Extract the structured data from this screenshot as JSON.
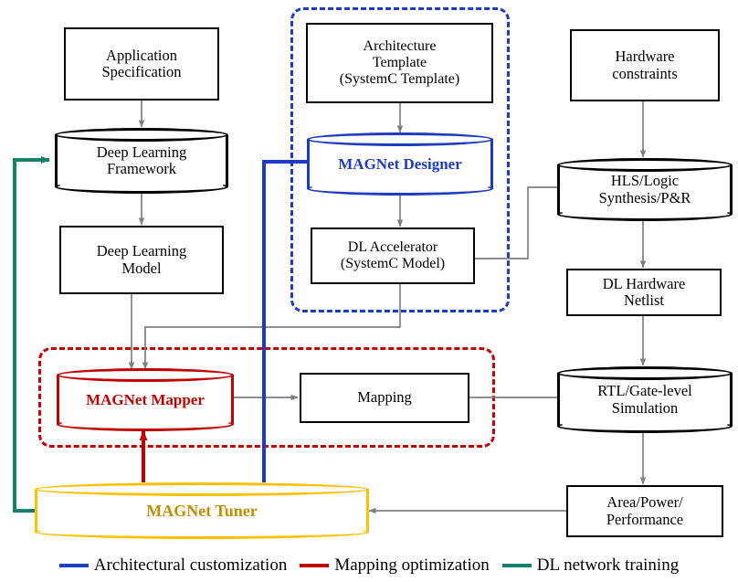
{
  "diagram": {
    "title": "MAGNet design flow",
    "colors": {
      "blue": "#1F3BBF",
      "red": "#C00000",
      "gold": "#FFC000",
      "gold_text": "#BF8F00",
      "teal": "#17806D",
      "arrow_gray": "#808080",
      "black": "#000000"
    },
    "nodes": {
      "application_specification": "Application\nSpecification",
      "deep_learning_framework": "Deep Learning\nFramework",
      "deep_learning_model": "Deep Learning\nModel",
      "architecture_template": "Architecture\nTemplate\n(SystemC  Template)",
      "magnet_designer": "MAGNet Designer",
      "dl_accelerator": "DL Accelerator\n(SystemC  Model)",
      "hardware_constraints": "Hardware\nconstraints",
      "hls_logic_synthesis": "HLS/Logic\nSynthesis/P&R",
      "dl_hardware_netlist": "DL Hardware\nNetlist",
      "rtl_gate_level_simulation": "RTL/Gate-level\nSimulation",
      "area_power_performance": "Area/Power/\nPerformance",
      "magnet_mapper": "MAGNet Mapper",
      "mapping": "Mapping",
      "magnet_tuner": "MAGNet Tuner"
    },
    "legend": [
      {
        "label": "Architectural customization",
        "color": "#1F3BBF"
      },
      {
        "label": "Mapping optimization",
        "color": "#C00000"
      },
      {
        "label": "DL network training",
        "color": "#17806D"
      }
    ]
  }
}
